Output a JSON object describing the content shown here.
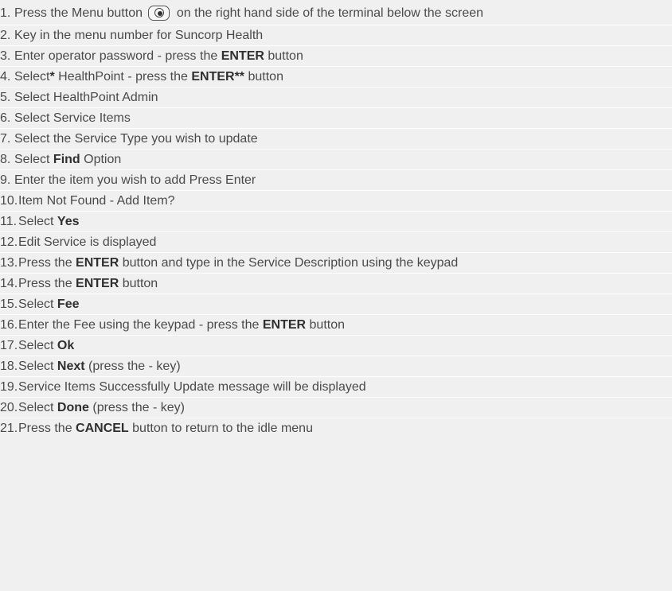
{
  "steps": [
    {
      "num": "1.",
      "parts": [
        {
          "t": "Press the Menu button "
        },
        {
          "icon": "menu-button-icon"
        },
        {
          "t": " on the right hand side of the terminal below the screen"
        }
      ]
    },
    {
      "num": "2.",
      "parts": [
        {
          "t": "Key in the menu number for Suncorp Health"
        }
      ]
    },
    {
      "num": "3.",
      "parts": [
        {
          "t": "Enter operator password - press the "
        },
        {
          "b": "ENTER"
        },
        {
          "t": " button"
        }
      ]
    },
    {
      "num": "4.",
      "parts": [
        {
          "t": "Select"
        },
        {
          "b": "*"
        },
        {
          "t": " HealthPoint - press the "
        },
        {
          "b": "ENTER**"
        },
        {
          "t": " button"
        }
      ]
    },
    {
      "num": "5.",
      "parts": [
        {
          "t": "Select HealthPoint Admin"
        }
      ]
    },
    {
      "num": "6.",
      "parts": [
        {
          "t": "Select Service Items"
        }
      ]
    },
    {
      "num": "7.",
      "parts": [
        {
          "t": "Select the Service Type you wish to update"
        }
      ]
    },
    {
      "num": "8.",
      "parts": [
        {
          "t": "Select "
        },
        {
          "b": "Find"
        },
        {
          "t": " Option"
        }
      ]
    },
    {
      "num": "9.",
      "parts": [
        {
          "t": "Enter the item you wish to add Press Enter"
        }
      ]
    },
    {
      "num": "10.",
      "parts": [
        {
          "t": "Item Not Found - Add Item?"
        }
      ]
    },
    {
      "num": "11.",
      "parts": [
        {
          "t": "Select "
        },
        {
          "b": "Yes"
        }
      ]
    },
    {
      "num": "12.",
      "parts": [
        {
          "t": "Edit Service is displayed"
        }
      ]
    },
    {
      "num": "13.",
      "parts": [
        {
          "t": "Press the "
        },
        {
          "b": "ENTER"
        },
        {
          "t": " button and type in the Service Description using the keypad"
        }
      ]
    },
    {
      "num": "14.",
      "parts": [
        {
          "t": "Press the "
        },
        {
          "b": "ENTER"
        },
        {
          "t": " button"
        }
      ]
    },
    {
      "num": "15.",
      "parts": [
        {
          "t": "Select "
        },
        {
          "b": "Fee"
        }
      ]
    },
    {
      "num": "16.",
      "parts": [
        {
          "t": "Enter the Fee using the keypad - press the "
        },
        {
          "b": "ENTER"
        },
        {
          "t": " button"
        }
      ]
    },
    {
      "num": "17.",
      "parts": [
        {
          "t": "Select "
        },
        {
          "b": "Ok"
        }
      ]
    },
    {
      "num": "18.",
      "parts": [
        {
          "t": "Select "
        },
        {
          "b": "Next"
        },
        {
          "t": " (press the - key)"
        }
      ]
    },
    {
      "num": "19.",
      "parts": [
        {
          "t": "Service Items Successfully Update message will be displayed"
        }
      ]
    },
    {
      "num": "20.",
      "parts": [
        {
          "t": "Select "
        },
        {
          "b": "Done"
        },
        {
          "t": " (press the - key)"
        }
      ]
    },
    {
      "num": "21.",
      "parts": [
        {
          "t": "Press the "
        },
        {
          "b": "CANCEL"
        },
        {
          "t": " button to return to the idle menu"
        }
      ]
    }
  ],
  "colors": {
    "background": "#f0f0f0",
    "text": "#4a4a4a",
    "bold_text": "#2f2f2f",
    "separator": "#ffffff"
  }
}
